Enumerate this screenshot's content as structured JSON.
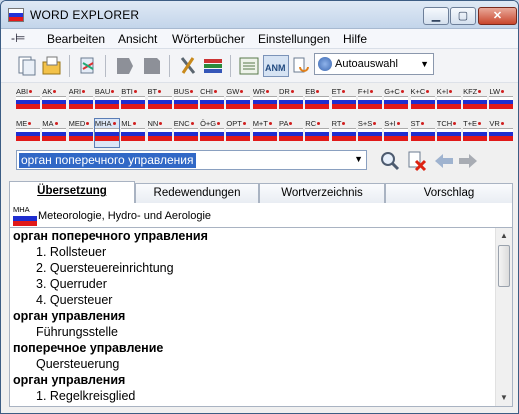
{
  "window": {
    "title": "WORD EXPLORER",
    "buttons": {
      "minimize": "▁",
      "maximize": "▢",
      "close": "✕"
    }
  },
  "menu": [
    "Bearbeiten",
    "Ansicht",
    "Wörterbücher",
    "Einstellungen",
    "Hilfe"
  ],
  "toolbar": {
    "icons": [
      "new-document-icon",
      "open-folder-icon",
      "refresh-icon",
      "back-page-icon",
      "forward-page-icon",
      "tools-icon",
      "books-icon",
      "list-view-icon",
      "anm-view-icon",
      "find-replace-icon"
    ],
    "anm_label": "ANM",
    "autoselect": "Autoauswahl"
  },
  "dictionaries_row1": [
    "ABI",
    "AK",
    "ARI",
    "BAU",
    "BTI",
    "BT",
    "BUS",
    "CHI",
    "GW",
    "WR",
    "DR",
    "EB",
    "ET",
    "F+I",
    "G+C",
    "K+C",
    "K+I",
    "KFZ",
    "LW"
  ],
  "dictionaries_row2": [
    "ME",
    "MA",
    "MED",
    "MHA",
    "ML",
    "NN",
    "ENC",
    "Ö+G",
    "OPT",
    "M+T",
    "PA",
    "RC",
    "RT",
    "S+S",
    "S+I",
    "ST",
    "TCH",
    "T+E",
    "VR"
  ],
  "selected_dictionary": "MHA",
  "search": {
    "value": "орган поперечного управления"
  },
  "tabs": [
    "Übersetzung",
    "Redewendungen",
    "Wortverzeichnis",
    "Vorschlag"
  ],
  "domain": {
    "code": "MHA",
    "label": "Meteorologie, Hydro- und Aerologie"
  },
  "results": [
    {
      "type": "h",
      "text": "орган поперечного управления"
    },
    {
      "type": "t",
      "text": "1. Rollsteuer"
    },
    {
      "type": "t",
      "text": "2. Quersteuereinrichtung"
    },
    {
      "type": "t",
      "text": "3. Querruder"
    },
    {
      "type": "t",
      "text": "4. Quersteuer"
    },
    {
      "type": "h",
      "text": "орган управления"
    },
    {
      "type": "t",
      "text": "Führungsstelle"
    },
    {
      "type": "h",
      "text": "поперечное управление"
    },
    {
      "type": "t",
      "text": "Quersteuerung"
    },
    {
      "type": "h",
      "text": "орган управления"
    },
    {
      "type": "t",
      "text": "1. Regelkreisglied"
    }
  ],
  "colors": {
    "flag_blue": "#1f2ed0",
    "flag_red": "#e11919",
    "selection": "#3168c6"
  }
}
